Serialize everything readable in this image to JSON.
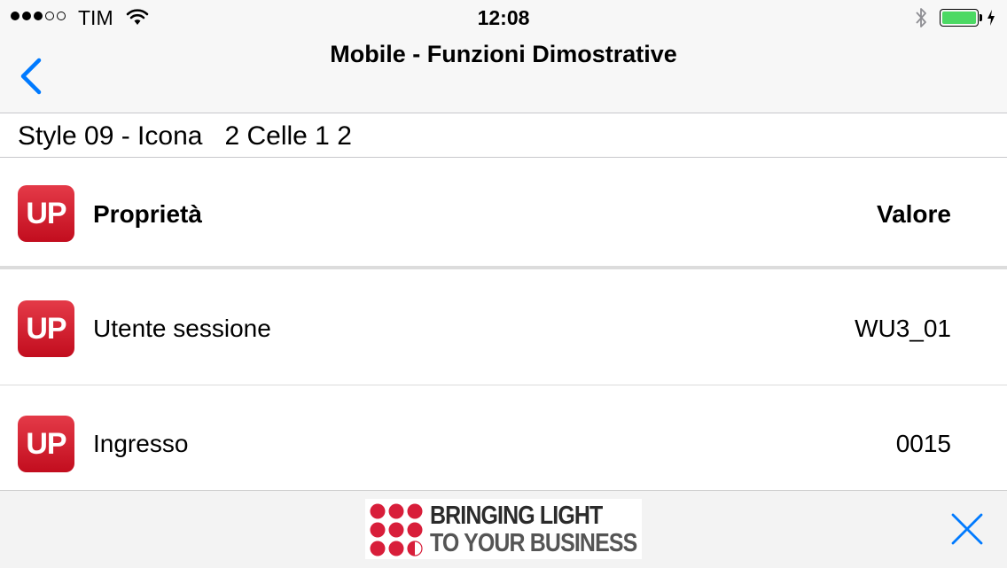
{
  "status_bar": {
    "carrier": "TIM",
    "time": "12:08",
    "signal_bars_filled": 3,
    "signal_bars_total": 5,
    "battery_level": 1.0,
    "battery_color": "#4cd964"
  },
  "navbar": {
    "title": "Mobile - Funzioni Dimostrative",
    "back_icon": "chevron-left-icon",
    "accent": "#007aff"
  },
  "section": {
    "title": "Style 09 - Icona   2 Celle 1 2"
  },
  "table": {
    "icon_text": "UP",
    "icon_color": "#d3162a",
    "header": {
      "label": "Proprietà",
      "value": "Valore"
    },
    "rows": [
      {
        "label": "Utente sessione",
        "value": "WU3_01"
      },
      {
        "label": "Ingresso",
        "value": "0015"
      }
    ]
  },
  "ad": {
    "line1": "BRINGING LIGHT",
    "line2": "TO YOUR BUSINESS",
    "close_icon": "close-icon"
  }
}
